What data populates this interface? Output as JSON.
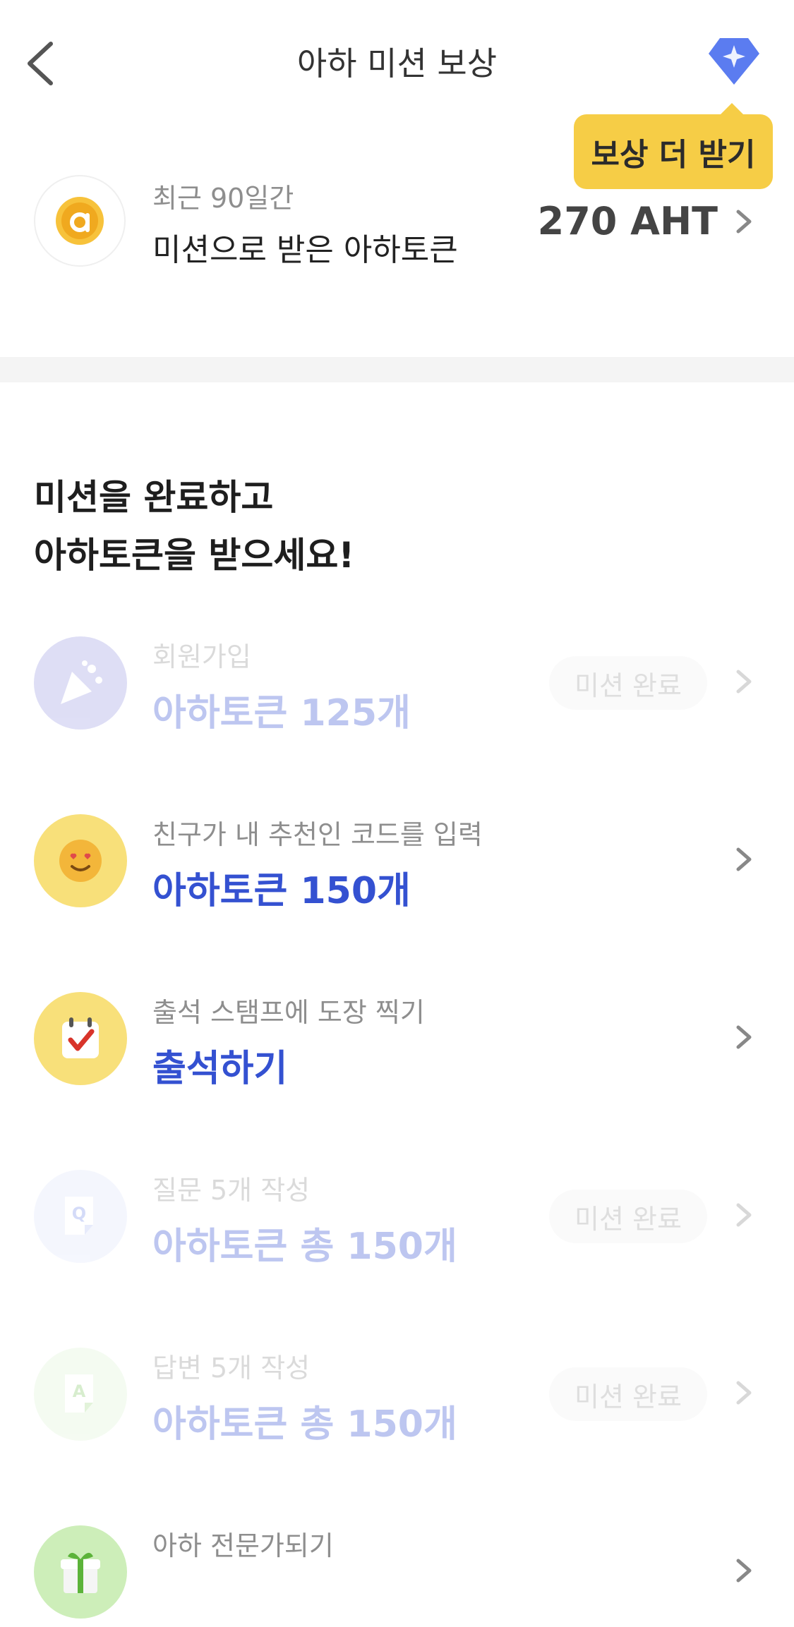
{
  "header": {
    "title": "아하 미션 보상",
    "tooltip": "보상 더 받기"
  },
  "summary": {
    "period": "최근 90일간",
    "label": "미션으로 받은 아하토큰",
    "amount": "270 AHT"
  },
  "headline": {
    "line1": "미션을 완료하고",
    "line2": "아하토큰을 받으세요!"
  },
  "missions": [
    {
      "title": "회원가입",
      "reward": "아하토큰 125개",
      "badge": "미션 완료",
      "icon": "party-popper-icon"
    },
    {
      "title": "친구가 내 추천인 코드를 입력",
      "reward": "아하토큰 150개",
      "icon": "heart-eyes-face-icon"
    },
    {
      "title": "출석 스탬프에 도장 찍기",
      "reward": "출석하기",
      "icon": "calendar-check-icon"
    },
    {
      "title": "질문 5개 작성",
      "reward": "아하토큰 총 150개",
      "badge": "미션 완료",
      "icon": "question-card-icon"
    },
    {
      "title": "답변 5개 작성",
      "reward": "아하토큰 총 150개",
      "badge": "미션 완료",
      "icon": "answer-card-icon"
    },
    {
      "title": "아하 전문가되기",
      "reward": "",
      "icon": "gift-box-icon"
    }
  ],
  "colors": {
    "accent": "#3451d1",
    "tooltip": "#f6cd46",
    "gem": "#5b7cf0"
  }
}
